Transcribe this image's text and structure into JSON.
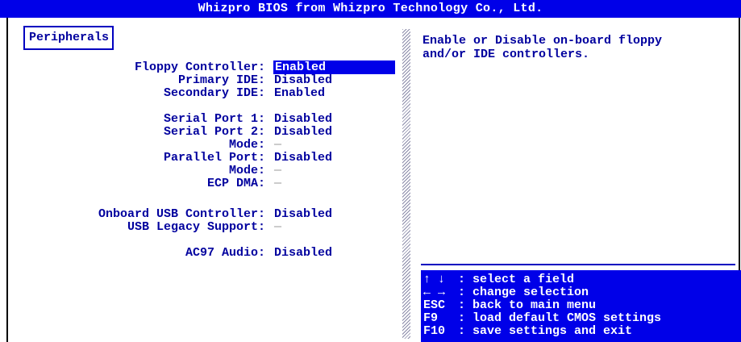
{
  "window": {
    "title": "Whizpro BIOS from Whizpro Technology Co., Ltd."
  },
  "section": {
    "title": "Peripherals"
  },
  "settings": [
    {
      "label": "Floppy Controller:",
      "value": "Enabled",
      "state": "selected"
    },
    {
      "label": "Primary IDE:",
      "value": "Disabled",
      "state": "normal"
    },
    {
      "label": "Secondary IDE:",
      "value": "Enabled",
      "state": "normal"
    },
    {
      "label": "Serial Port 1:",
      "value": "Disabled",
      "state": "normal"
    },
    {
      "label": "Serial Port 2:",
      "value": "Disabled",
      "state": "normal"
    },
    {
      "label": "Mode:",
      "value": "—",
      "state": "unavailable"
    },
    {
      "label": "Parallel Port:",
      "value": "Disabled",
      "state": "normal"
    },
    {
      "label": "Mode:",
      "value": "—",
      "state": "unavailable"
    },
    {
      "label": "ECP DMA:",
      "value": "—",
      "state": "unavailable"
    },
    {
      "label": "Onboard USB Controller:",
      "value": "Disabled",
      "state": "normal"
    },
    {
      "label": "USB Legacy Support:",
      "value": "—",
      "state": "unavailable"
    },
    {
      "label": "AC97 Audio:",
      "value": "Disabled",
      "state": "normal"
    }
  ],
  "help": {
    "text": "Enable or Disable on-board floppy\nand/or IDE controllers."
  },
  "keys": [
    {
      "key": "↑ ↓",
      "sep": ":",
      "desc": "select a field"
    },
    {
      "key": "← →",
      "sep": ":",
      "desc": "change selection"
    },
    {
      "key": "ESC",
      "sep": ":",
      "desc": "back to main menu"
    },
    {
      "key": "F9",
      "sep": ":",
      "desc": "load default CMOS settings"
    },
    {
      "key": "F10",
      "sep": ":",
      "desc": "save settings and exit"
    }
  ],
  "colors": {
    "title_bar": "#0000e8",
    "text": "#00009e",
    "highlight": "#0000e8",
    "unavailable": "#9a9a9a"
  }
}
